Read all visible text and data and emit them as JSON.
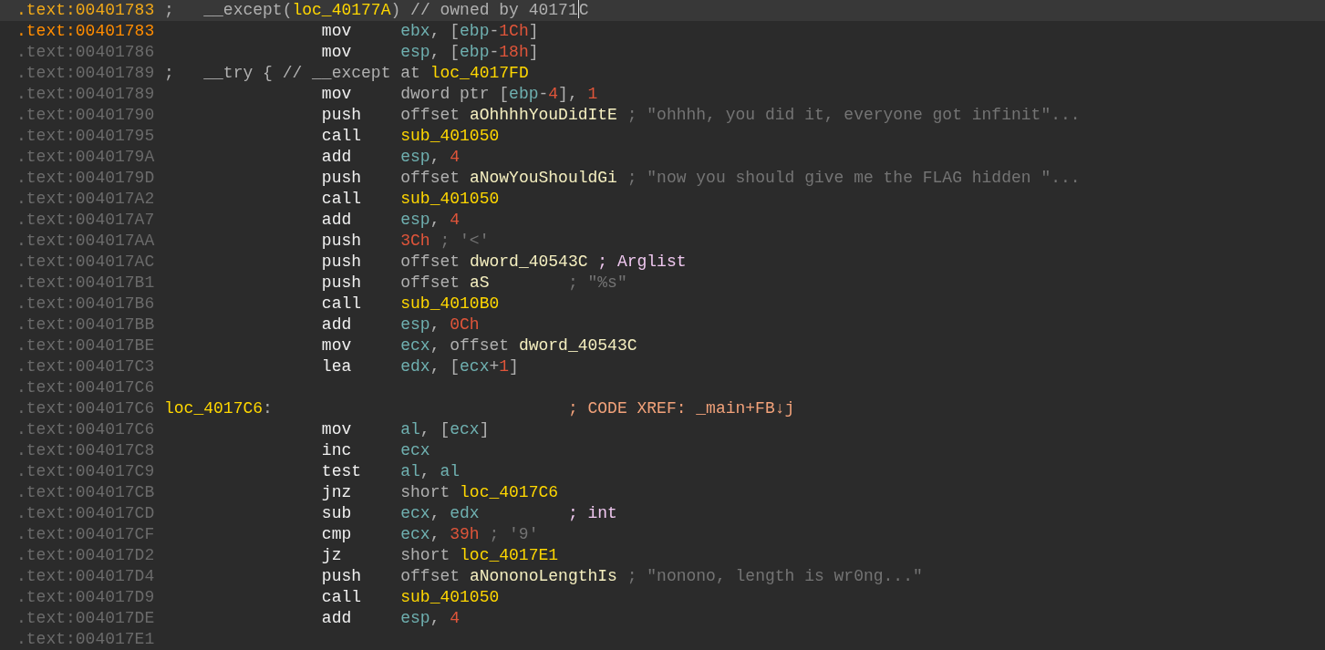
{
  "lines": [
    {
      "address": ".text:00401783",
      "selected": true,
      "highlighted": false,
      "note": [
        {
          "t": ";   __except(",
          "kind": "plain"
        },
        {
          "t": "loc_40177A",
          "kind": "name"
        },
        {
          "t": ") // owned by 40171",
          "kind": "plain"
        },
        {
          "t": "C",
          "kind": "plain",
          "caret": true
        }
      ]
    },
    {
      "address": ".text:00401783",
      "selected": false,
      "highlighted": true,
      "mnemonic": "mov",
      "operands": [
        {
          "t": "ebx",
          "kind": "register"
        },
        {
          "t": ", [",
          "kind": "plain"
        },
        {
          "t": "ebp",
          "kind": "register"
        },
        {
          "t": "-",
          "kind": "plain"
        },
        {
          "t": "1Ch",
          "kind": "number"
        },
        {
          "t": "]",
          "kind": "plain"
        }
      ]
    },
    {
      "address": ".text:00401786",
      "selected": false,
      "highlighted": false,
      "mnemonic": "mov",
      "operands": [
        {
          "t": "esp",
          "kind": "register"
        },
        {
          "t": ", [",
          "kind": "plain"
        },
        {
          "t": "ebp",
          "kind": "register"
        },
        {
          "t": "-",
          "kind": "plain"
        },
        {
          "t": "18h",
          "kind": "number"
        },
        {
          "t": "]",
          "kind": "plain"
        }
      ]
    },
    {
      "address": ".text:00401789",
      "selected": false,
      "highlighted": false,
      "note": [
        {
          "t": ";   __try { // __except at ",
          "kind": "plain"
        },
        {
          "t": "loc_4017FD",
          "kind": "name"
        }
      ]
    },
    {
      "address": ".text:00401789",
      "selected": false,
      "highlighted": false,
      "mnemonic": "mov",
      "operands": [
        {
          "t": "dword ptr [",
          "kind": "plain"
        },
        {
          "t": "ebp",
          "kind": "register"
        },
        {
          "t": "-",
          "kind": "plain"
        },
        {
          "t": "4",
          "kind": "number"
        },
        {
          "t": "], ",
          "kind": "plain"
        },
        {
          "t": "1",
          "kind": "number"
        }
      ]
    },
    {
      "address": ".text:00401790",
      "selected": false,
      "highlighted": false,
      "mnemonic": "push",
      "operands": [
        {
          "t": "offset ",
          "kind": "plain"
        },
        {
          "t": "aOhhhhYouDidItE",
          "kind": "symbol"
        }
      ],
      "comment": {
        "text": "; \"ohhhh, you did it, everyone got infinit\"...",
        "kind": "string",
        "aligned": false
      }
    },
    {
      "address": ".text:00401795",
      "selected": false,
      "highlighted": false,
      "mnemonic": "call",
      "operands": [
        {
          "t": "sub_401050",
          "kind": "name"
        }
      ]
    },
    {
      "address": ".text:0040179A",
      "selected": false,
      "highlighted": false,
      "mnemonic": "add",
      "operands": [
        {
          "t": "esp",
          "kind": "register"
        },
        {
          "t": ", ",
          "kind": "plain"
        },
        {
          "t": "4",
          "kind": "number"
        }
      ]
    },
    {
      "address": ".text:0040179D",
      "selected": false,
      "highlighted": false,
      "mnemonic": "push",
      "operands": [
        {
          "t": "offset ",
          "kind": "plain"
        },
        {
          "t": "aNowYouShouldGi",
          "kind": "symbol"
        }
      ],
      "comment": {
        "text": "; \"now you should give me the FLAG hidden \"...",
        "kind": "string",
        "aligned": false
      }
    },
    {
      "address": ".text:004017A2",
      "selected": false,
      "highlighted": false,
      "mnemonic": "call",
      "operands": [
        {
          "t": "sub_401050",
          "kind": "name"
        }
      ]
    },
    {
      "address": ".text:004017A7",
      "selected": false,
      "highlighted": false,
      "mnemonic": "add",
      "operands": [
        {
          "t": "esp",
          "kind": "register"
        },
        {
          "t": ", ",
          "kind": "plain"
        },
        {
          "t": "4",
          "kind": "number"
        }
      ]
    },
    {
      "address": ".text:004017AA",
      "selected": false,
      "highlighted": false,
      "mnemonic": "push",
      "operands": [
        {
          "t": "3Ch",
          "kind": "number"
        }
      ],
      "comment": {
        "text": "; '<'",
        "kind": "string",
        "aligned": false
      }
    },
    {
      "address": ".text:004017AC",
      "selected": false,
      "highlighted": false,
      "mnemonic": "push",
      "operands": [
        {
          "t": "offset ",
          "kind": "plain"
        },
        {
          "t": "dword_40543C",
          "kind": "symbol"
        }
      ],
      "comment": {
        "text": "; Arglist",
        "kind": "type",
        "aligned": false
      }
    },
    {
      "address": ".text:004017B1",
      "selected": false,
      "highlighted": false,
      "mnemonic": "push",
      "operands": [
        {
          "t": "offset ",
          "kind": "plain"
        },
        {
          "t": "aS",
          "kind": "symbol"
        }
      ],
      "comment": {
        "text": "; \"%s\"",
        "kind": "string",
        "aligned": true
      }
    },
    {
      "address": ".text:004017B6",
      "selected": false,
      "highlighted": false,
      "mnemonic": "call",
      "operands": [
        {
          "t": "sub_4010B0",
          "kind": "name"
        }
      ]
    },
    {
      "address": ".text:004017BB",
      "selected": false,
      "highlighted": false,
      "mnemonic": "add",
      "operands": [
        {
          "t": "esp",
          "kind": "register"
        },
        {
          "t": ", ",
          "kind": "plain"
        },
        {
          "t": "0Ch",
          "kind": "number"
        }
      ]
    },
    {
      "address": ".text:004017BE",
      "selected": false,
      "highlighted": false,
      "mnemonic": "mov",
      "operands": [
        {
          "t": "ecx",
          "kind": "register"
        },
        {
          "t": ", offset ",
          "kind": "plain"
        },
        {
          "t": "dword_40543C",
          "kind": "symbol"
        }
      ]
    },
    {
      "address": ".text:004017C3",
      "selected": false,
      "highlighted": false,
      "mnemonic": "lea",
      "operands": [
        {
          "t": "edx",
          "kind": "register"
        },
        {
          "t": ", [",
          "kind": "plain"
        },
        {
          "t": "ecx",
          "kind": "register"
        },
        {
          "t": "+",
          "kind": "plain"
        },
        {
          "t": "1",
          "kind": "number"
        },
        {
          "t": "]",
          "kind": "plain"
        }
      ]
    },
    {
      "address": ".text:004017C6",
      "selected": false,
      "highlighted": false
    },
    {
      "address": ".text:004017C6",
      "selected": false,
      "highlighted": false,
      "label": [
        {
          "t": "loc_4017C6",
          "kind": "name"
        },
        {
          "t": ":",
          "kind": "plain"
        }
      ],
      "comment": {
        "text": "; CODE XREF: _main+FB↓j",
        "kind": "xref",
        "aligned": true
      }
    },
    {
      "address": ".text:004017C6",
      "selected": false,
      "highlighted": false,
      "mnemonic": "mov",
      "operands": [
        {
          "t": "al",
          "kind": "register"
        },
        {
          "t": ", [",
          "kind": "plain"
        },
        {
          "t": "ecx",
          "kind": "register"
        },
        {
          "t": "]",
          "kind": "plain"
        }
      ]
    },
    {
      "address": ".text:004017C8",
      "selected": false,
      "highlighted": false,
      "mnemonic": "inc",
      "operands": [
        {
          "t": "ecx",
          "kind": "register"
        }
      ]
    },
    {
      "address": ".text:004017C9",
      "selected": false,
      "highlighted": false,
      "mnemonic": "test",
      "operands": [
        {
          "t": "al",
          "kind": "register"
        },
        {
          "t": ", ",
          "kind": "plain"
        },
        {
          "t": "al",
          "kind": "register"
        }
      ]
    },
    {
      "address": ".text:004017CB",
      "selected": false,
      "highlighted": false,
      "mnemonic": "jnz",
      "operands": [
        {
          "t": "short ",
          "kind": "plain"
        },
        {
          "t": "loc_4017C6",
          "kind": "name"
        }
      ]
    },
    {
      "address": ".text:004017CD",
      "selected": false,
      "highlighted": false,
      "mnemonic": "sub",
      "operands": [
        {
          "t": "ecx",
          "kind": "register"
        },
        {
          "t": ", ",
          "kind": "plain"
        },
        {
          "t": "edx",
          "kind": "register"
        }
      ],
      "comment": {
        "text": "; int",
        "kind": "type",
        "aligned": true
      }
    },
    {
      "address": ".text:004017CF",
      "selected": false,
      "highlighted": false,
      "mnemonic": "cmp",
      "operands": [
        {
          "t": "ecx",
          "kind": "register"
        },
        {
          "t": ", ",
          "kind": "plain"
        },
        {
          "t": "39h",
          "kind": "number"
        }
      ],
      "comment": {
        "text": "; '9'",
        "kind": "string",
        "aligned": false
      }
    },
    {
      "address": ".text:004017D2",
      "selected": false,
      "highlighted": false,
      "mnemonic": "jz",
      "operands": [
        {
          "t": "short ",
          "kind": "plain"
        },
        {
          "t": "loc_4017E1",
          "kind": "name"
        }
      ]
    },
    {
      "address": ".text:004017D4",
      "selected": false,
      "highlighted": false,
      "mnemonic": "push",
      "operands": [
        {
          "t": "offset ",
          "kind": "plain"
        },
        {
          "t": "aNononoLengthIs",
          "kind": "symbol"
        }
      ],
      "comment": {
        "text": "; \"nonono, length is wr0ng...\"",
        "kind": "string",
        "aligned": false
      }
    },
    {
      "address": ".text:004017D9",
      "selected": false,
      "highlighted": false,
      "mnemonic": "call",
      "operands": [
        {
          "t": "sub_401050",
          "kind": "name"
        }
      ]
    },
    {
      "address": ".text:004017DE",
      "selected": false,
      "highlighted": false,
      "mnemonic": "add",
      "operands": [
        {
          "t": "esp",
          "kind": "register"
        },
        {
          "t": ", ",
          "kind": "plain"
        },
        {
          "t": "4",
          "kind": "number"
        }
      ]
    },
    {
      "address": ".text:004017E1",
      "selected": false,
      "highlighted": false
    }
  ]
}
